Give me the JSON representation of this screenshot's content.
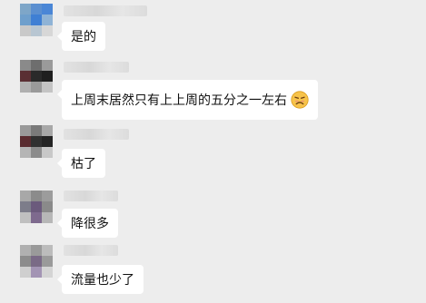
{
  "messages": [
    {
      "text": "是的"
    },
    {
      "text": "上周末居然只有上上周的五分之一左右",
      "emoji": "frowning-face-icon"
    },
    {
      "text": "枯了"
    },
    {
      "text": "降很多"
    },
    {
      "text": "流量也少了"
    }
  ]
}
